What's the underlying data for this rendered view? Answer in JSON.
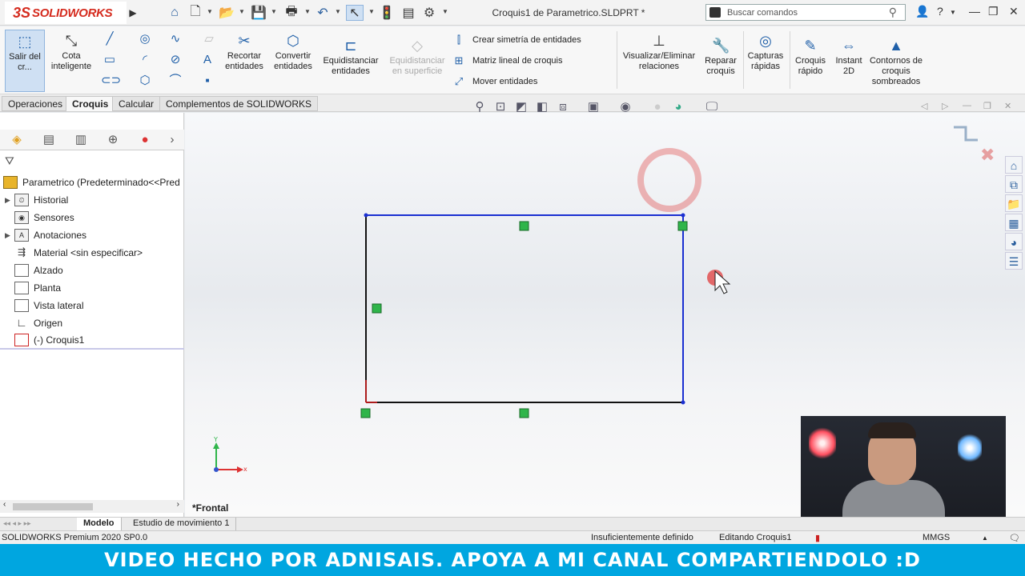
{
  "app": {
    "logo_text": "SOLIDWORKS",
    "document_title": "Croquis1 de Parametrico.SLDPRT *",
    "search_placeholder": "Buscar comandos"
  },
  "ribbon": {
    "exit_sketch": "Salir del cr...",
    "smart_dimension": "Cota inteligente",
    "trim": "Recortar entidades",
    "convert": "Convertir entidades",
    "offset": "Equidistanciar entidades",
    "offset_surface": "Equidistanciar en superficie",
    "mirror": "Crear simetría de entidades",
    "linear_pattern": "Matriz lineal de croquis",
    "move": "Mover entidades",
    "display_relations": "Visualizar/Eliminar relaciones",
    "repair": "Reparar croquis",
    "quick_snaps": "Capturas rápidas",
    "rapid_sketch": "Croquis rápido",
    "instant2d": "Instant 2D",
    "shaded_contours": "Contornos de croquis sombreados"
  },
  "tabs": [
    "Operaciones",
    "Croquis",
    "Calcular",
    "Complementos de SOLIDWORKS"
  ],
  "active_tab": "Croquis",
  "tree": {
    "root": "Parametrico  (Predeterminado<<Pred",
    "items": [
      {
        "label": "Historial",
        "expandable": true,
        "icon": "history-icon"
      },
      {
        "label": "Sensores",
        "expandable": false,
        "icon": "sensor-icon"
      },
      {
        "label": "Anotaciones",
        "expandable": true,
        "icon": "annotation-icon"
      },
      {
        "label": "Material <sin especificar>",
        "expandable": false,
        "icon": "material-icon"
      },
      {
        "label": "Alzado",
        "expandable": false,
        "icon": "plane-icon"
      },
      {
        "label": "Planta",
        "expandable": false,
        "icon": "plane-icon"
      },
      {
        "label": "Vista lateral",
        "expandable": false,
        "icon": "plane-icon"
      },
      {
        "label": "Origen",
        "expandable": false,
        "icon": "origin-icon"
      },
      {
        "label": "(-) Croquis1",
        "expandable": false,
        "icon": "sketch-icon"
      }
    ]
  },
  "viewport": {
    "view_name": "*Frontal",
    "axis_x": "x",
    "axis_y": "Y"
  },
  "bottom_tabs": [
    "Modelo",
    "Estudio de movimiento 1"
  ],
  "status": {
    "version": "SOLIDWORKS Premium 2020 SP0.0",
    "definition": "Insuficientemente definido",
    "editing": "Editando Croquis1",
    "units": "MMGS"
  },
  "banner": "VIDEO HECHO POR ADNISAIS. APOYA A MI CANAL COMPARTIENDOLO :D",
  "colors": {
    "sketch_line": "#1a2fd1",
    "relation_marker": "#2fb54a",
    "banner": "#00a6e0",
    "brand": "#d52b1e"
  }
}
